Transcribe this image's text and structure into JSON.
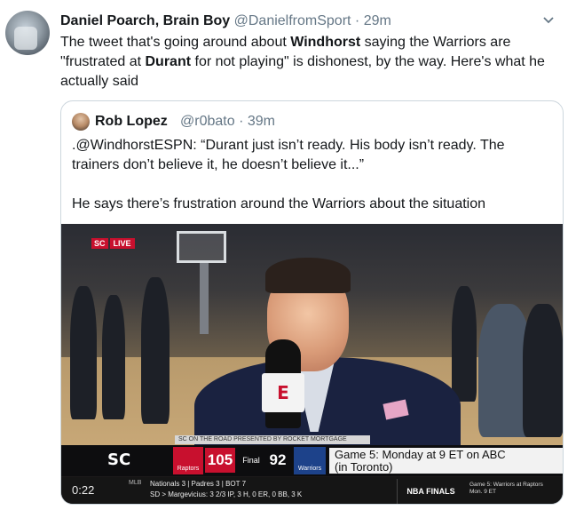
{
  "tweet": {
    "author_name": "Daniel Poarch, Brain Boy",
    "handle": "@DanielfromSport",
    "separator": "·",
    "time": "29m",
    "text_parts": [
      "The tweet that's going around about ",
      "Windhorst",
      " saying the Warriors are \"frustrated at ",
      "Durant",
      " for not playing\" is dishonest, by the way. Here's what he actually said"
    ]
  },
  "quoted": {
    "author_name": "Rob Lopez",
    "handle": "@r0bato",
    "separator": "·",
    "time": "39m",
    "text_line1": ".@WindhorstESPN: “Durant just isn’t ready. His body isn’t ready. The trainers don’t believe it, he doesn’t believe it...”",
    "text_line2": "He says there’s frustration around the Warriors about the situation"
  },
  "video": {
    "bug_brand": "SC",
    "bug_live": "LIVE",
    "mic_flag": "E",
    "ticker_top": "SC ON THE ROAD   PRESENTED BY ROCKET MORTGAGE",
    "scorebug_brand": "SC",
    "team1_name": "Raptors",
    "team1_score": "105",
    "status": "Final",
    "team2_score": "92",
    "team2_name": "Warriors",
    "note_line1": "Game 5: Monday at 9 ET on ABC",
    "note_line2": "(in Toronto)",
    "clock": "0:22",
    "league": "MLB",
    "mlb_line1": "Nationals        3 | Padres              3 | BOT 7",
    "mlb_line2": "SD > Margevicius: 3 2/3 IP, 3 H, 0 ER, 0 BB, 3 K",
    "finals_label": "NBA FINALS",
    "next_line1": "Game 5: Warriors at Raptors",
    "next_line2": "Mon. 9 ET"
  }
}
